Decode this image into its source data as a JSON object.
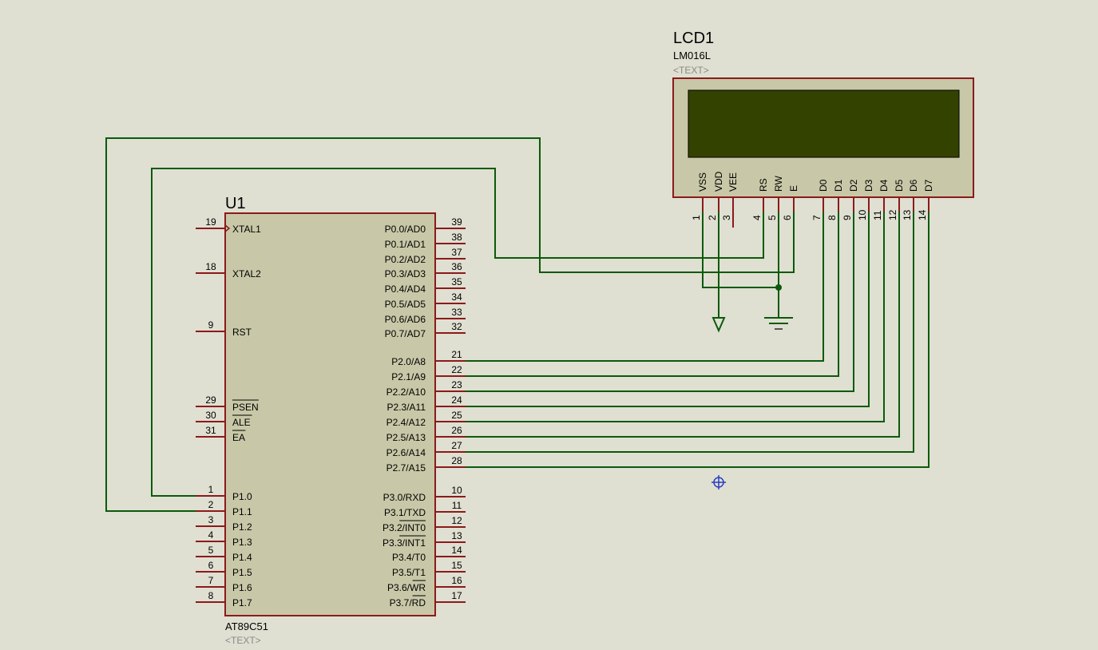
{
  "u1": {
    "ref": "U1",
    "value": "AT89C51",
    "text": "<TEXT>",
    "left_pins": [
      {
        "num": "19",
        "name": "XTAL1"
      },
      {
        "num": "18",
        "name": "XTAL2"
      },
      {
        "num": "9",
        "name": "RST"
      },
      {
        "num": "29",
        "name": "PSEN"
      },
      {
        "num": "30",
        "name": "ALE"
      },
      {
        "num": "31",
        "name": "EA"
      },
      {
        "num": "1",
        "name": "P1.0"
      },
      {
        "num": "2",
        "name": "P1.1"
      },
      {
        "num": "3",
        "name": "P1.2"
      },
      {
        "num": "4",
        "name": "P1.3"
      },
      {
        "num": "5",
        "name": "P1.4"
      },
      {
        "num": "6",
        "name": "P1.5"
      },
      {
        "num": "7",
        "name": "P1.6"
      },
      {
        "num": "8",
        "name": "P1.7"
      }
    ],
    "right_pins": [
      {
        "num": "39",
        "name": "P0.0/AD0"
      },
      {
        "num": "38",
        "name": "P0.1/AD1"
      },
      {
        "num": "37",
        "name": "P0.2/AD2"
      },
      {
        "num": "36",
        "name": "P0.3/AD3"
      },
      {
        "num": "35",
        "name": "P0.4/AD4"
      },
      {
        "num": "34",
        "name": "P0.5/AD5"
      },
      {
        "num": "33",
        "name": "P0.6/AD6"
      },
      {
        "num": "32",
        "name": "P0.7/AD7"
      },
      {
        "num": "21",
        "name": "P2.0/A8"
      },
      {
        "num": "22",
        "name": "P2.1/A9"
      },
      {
        "num": "23",
        "name": "P2.2/A10"
      },
      {
        "num": "24",
        "name": "P2.3/A11"
      },
      {
        "num": "25",
        "name": "P2.4/A12"
      },
      {
        "num": "26",
        "name": "P2.5/A13"
      },
      {
        "num": "27",
        "name": "P2.6/A14"
      },
      {
        "num": "28",
        "name": "P2.7/A15"
      },
      {
        "num": "10",
        "name": "P3.0/RXD"
      },
      {
        "num": "11",
        "name": "P3.1/TXD"
      },
      {
        "num": "12",
        "name": "P3.2/INT0"
      },
      {
        "num": "13",
        "name": "P3.3/INT1"
      },
      {
        "num": "14",
        "name": "P3.4/T0"
      },
      {
        "num": "15",
        "name": "P3.5/T1"
      },
      {
        "num": "16",
        "name": "P3.6/WR"
      },
      {
        "num": "17",
        "name": "P3.7/RD"
      }
    ]
  },
  "lcd1": {
    "ref": "LCD1",
    "value": "LM016L",
    "text": "<TEXT>",
    "pins": [
      {
        "num": "1",
        "name": "VSS"
      },
      {
        "num": "2",
        "name": "VDD"
      },
      {
        "num": "3",
        "name": "VEE"
      },
      {
        "num": "4",
        "name": "RS"
      },
      {
        "num": "5",
        "name": "RW"
      },
      {
        "num": "6",
        "name": "E"
      },
      {
        "num": "7",
        "name": "D0"
      },
      {
        "num": "8",
        "name": "D1"
      },
      {
        "num": "9",
        "name": "D2"
      },
      {
        "num": "10",
        "name": "D3"
      },
      {
        "num": "11",
        "name": "D4"
      },
      {
        "num": "12",
        "name": "D5"
      },
      {
        "num": "13",
        "name": "D6"
      },
      {
        "num": "14",
        "name": "D7"
      }
    ]
  },
  "colors": {
    "background": "#dfdfd2",
    "wire": "#0b5a0b",
    "pin": "#8b1a1a",
    "body": "#c8c8a8",
    "screen": "#344200",
    "cursor": "#2b3fbf"
  }
}
